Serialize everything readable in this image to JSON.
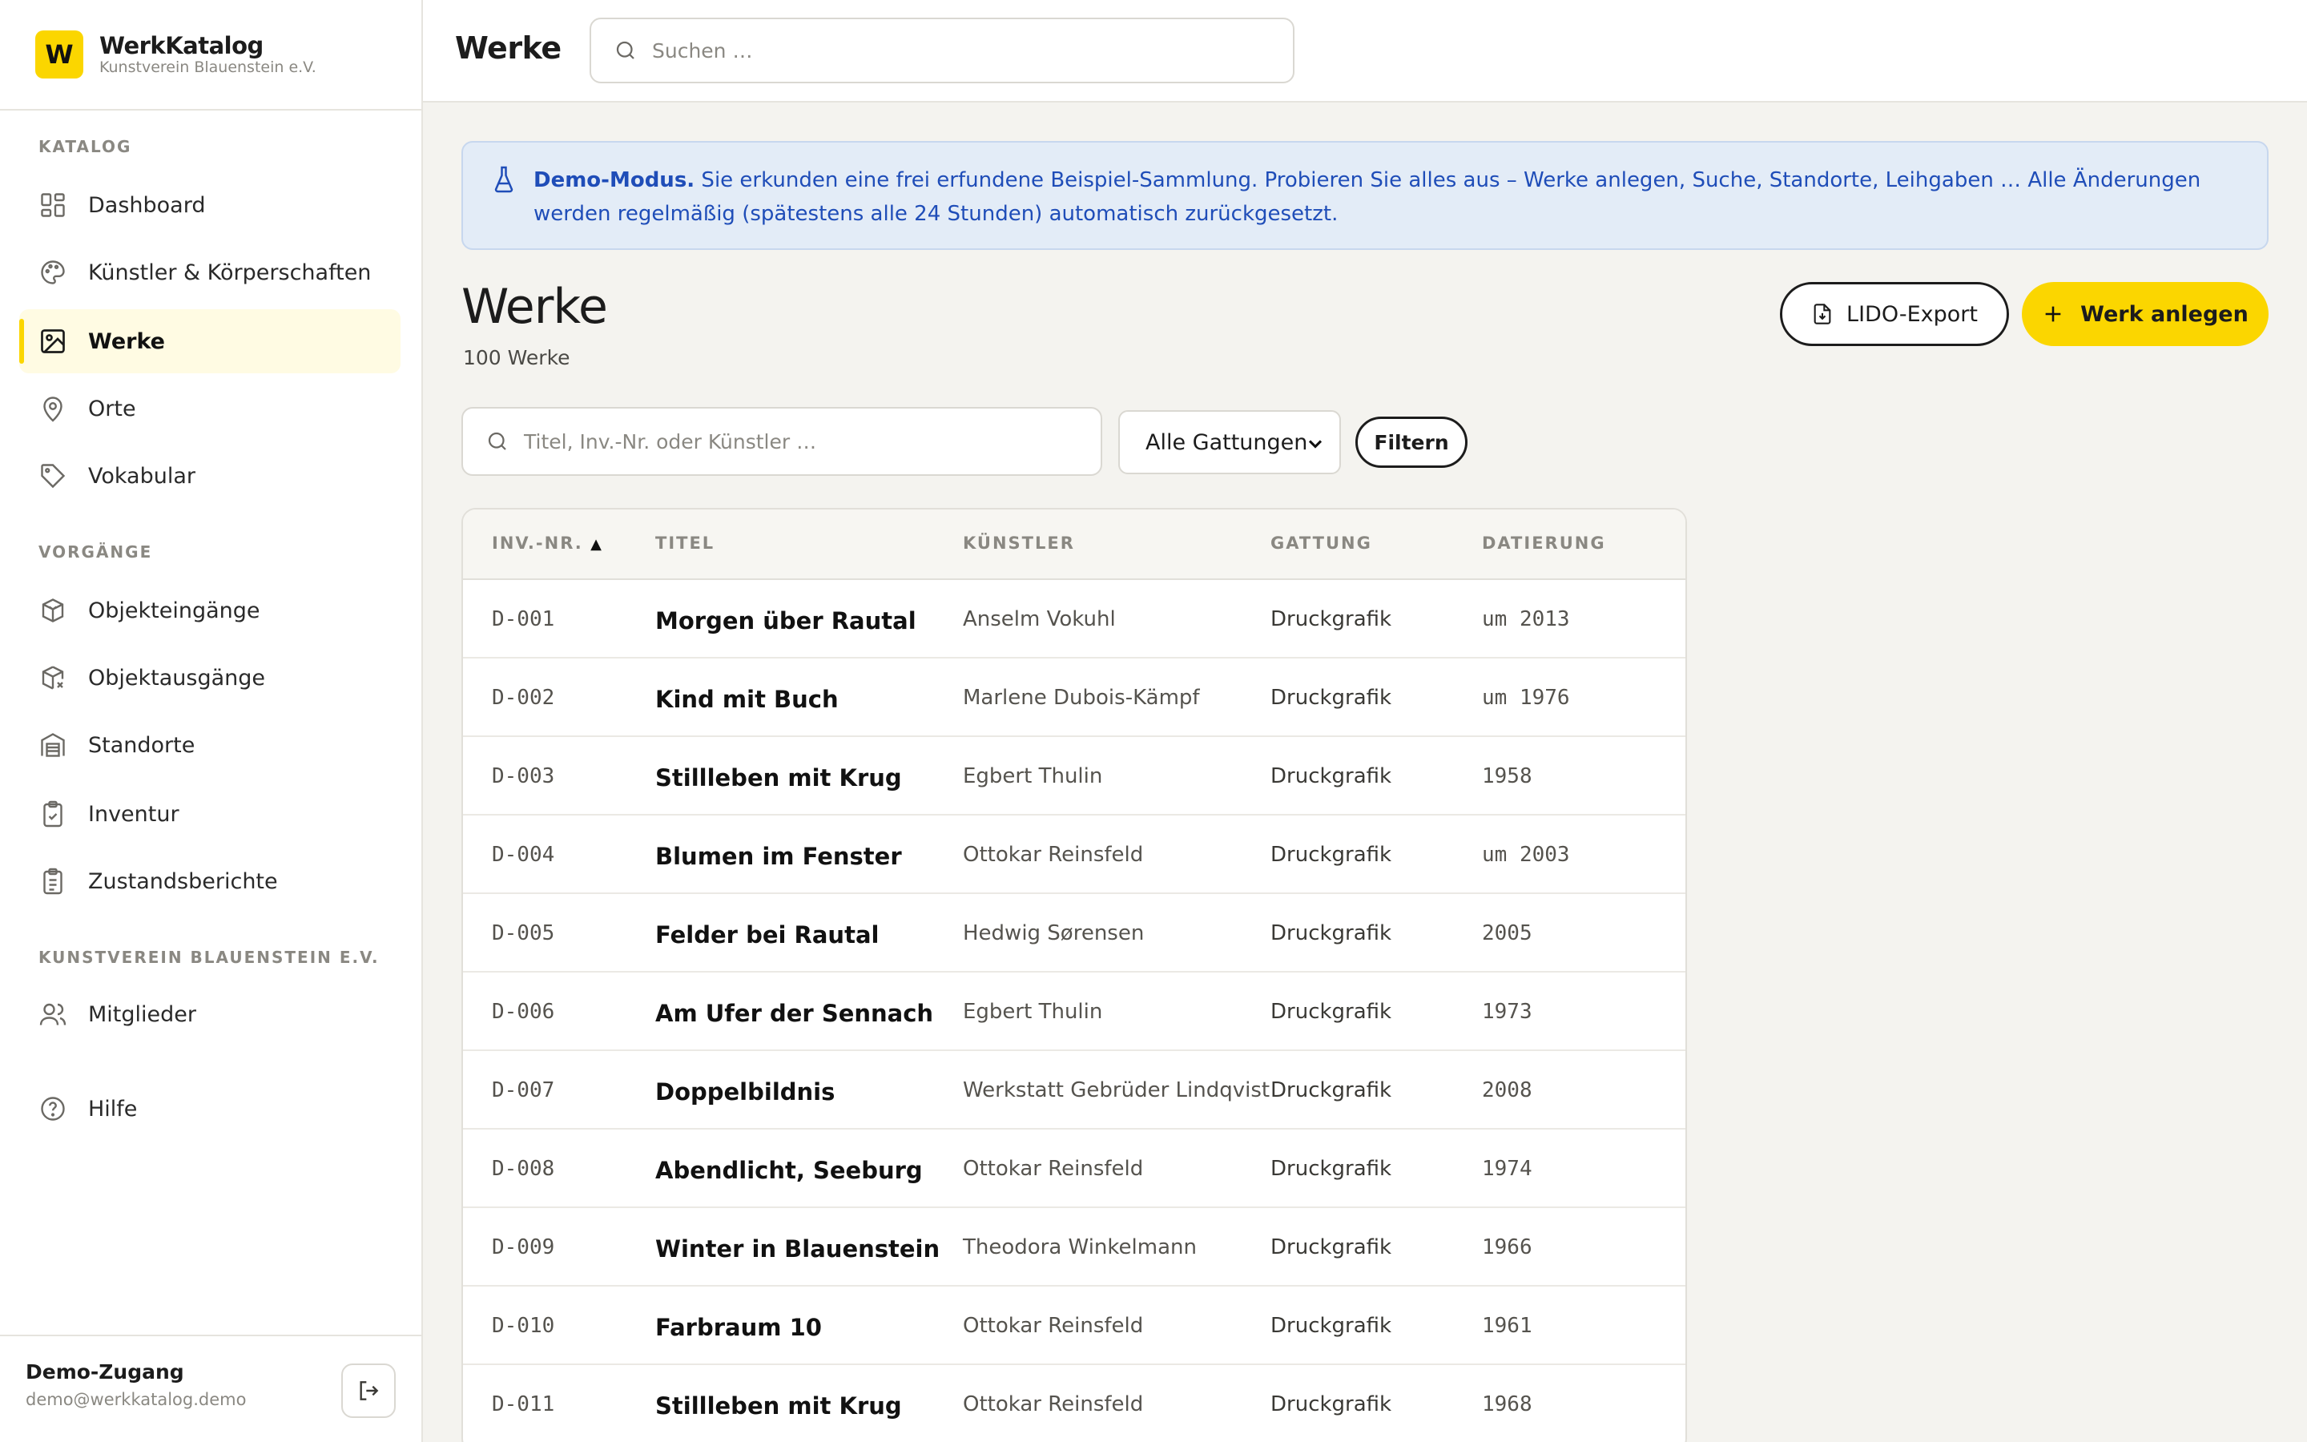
{
  "brand": {
    "logo_letter": "W",
    "name": "WerkKatalog",
    "subtitle": "Kunstverein Blauenstein e.V."
  },
  "sidebar": {
    "sections": {
      "katalog": "KATALOG",
      "vorgaenge": "VORGÄNGE",
      "verein": "KUNSTVEREIN BLAUENSTEIN E.V."
    },
    "items": [
      {
        "label": "Dashboard",
        "icon": "dashboard-icon"
      },
      {
        "label": "Künstler & Körperschaften",
        "icon": "palette-icon"
      },
      {
        "label": "Werke",
        "icon": "image-icon",
        "active": true
      },
      {
        "label": "Orte",
        "icon": "map-pin-icon"
      },
      {
        "label": "Vokabular",
        "icon": "tag-icon"
      },
      {
        "label": "Objekteingänge",
        "icon": "box-in-icon"
      },
      {
        "label": "Objektausgänge",
        "icon": "box-out-icon"
      },
      {
        "label": "Standorte",
        "icon": "warehouse-icon"
      },
      {
        "label": "Inventur",
        "icon": "clipboard-check-icon"
      },
      {
        "label": "Zustandsberichte",
        "icon": "clipboard-list-icon"
      },
      {
        "label": "Mitglieder",
        "icon": "users-icon"
      },
      {
        "label": "Hilfe",
        "icon": "help-icon"
      }
    ],
    "footer": {
      "user_name": "Demo-Zugang",
      "user_email": "demo@werkkatalog.demo"
    }
  },
  "topbar": {
    "title": "Werke",
    "search_placeholder": "Suchen …"
  },
  "banner": {
    "strong": "Demo-Modus.",
    "text": " Sie erkunden eine frei erfundene Beispiel-Sammlung. Probieren Sie alles aus – Werke anlegen, Suche, Standorte, Leihgaben … Alle Änderungen werden regelmäßig (spätestens alle 24 Stunden) automatisch zurückgesetzt."
  },
  "page": {
    "title": "Werke",
    "count": "100 Werke",
    "lido_button": "LIDO-Export",
    "new_button": "Werk anlegen"
  },
  "filters": {
    "search_placeholder": "Titel, Inv.-Nr. oder Künstler …",
    "genre_selected": "Alle Gattungen",
    "filter_button": "Filtern"
  },
  "table": {
    "columns": {
      "inv": "INV.-NR.",
      "sort_indicator": "▲",
      "title": "TITEL",
      "artist": "KÜNSTLER",
      "genre": "GATTUNG",
      "date": "DATIERUNG"
    },
    "rows": [
      {
        "inv": "D-001",
        "title": "Morgen über Rautal",
        "artist": "Anselm Vokuhl",
        "genre": "Druckgrafik",
        "date": "um 2013"
      },
      {
        "inv": "D-002",
        "title": "Kind mit Buch",
        "artist": "Marlene Dubois-Kämpf",
        "genre": "Druckgrafik",
        "date": "um 1976"
      },
      {
        "inv": "D-003",
        "title": "Stillleben mit Krug",
        "artist": "Egbert Thulin",
        "genre": "Druckgrafik",
        "date": "1958"
      },
      {
        "inv": "D-004",
        "title": "Blumen im Fenster",
        "artist": "Ottokar Reinsfeld",
        "genre": "Druckgrafik",
        "date": "um 2003"
      },
      {
        "inv": "D-005",
        "title": "Felder bei Rautal",
        "artist": "Hedwig Sørensen",
        "genre": "Druckgrafik",
        "date": "2005"
      },
      {
        "inv": "D-006",
        "title": "Am Ufer der Sennach",
        "artist": "Egbert Thulin",
        "genre": "Druckgrafik",
        "date": "1973"
      },
      {
        "inv": "D-007",
        "title": "Doppelbildnis",
        "artist": "Werkstatt Gebrüder Lindqvist",
        "genre": "Druckgrafik",
        "date": "2008"
      },
      {
        "inv": "D-008",
        "title": "Abendlicht, Seeburg",
        "artist": "Ottokar Reinsfeld",
        "genre": "Druckgrafik",
        "date": "1974"
      },
      {
        "inv": "D-009",
        "title": "Winter in Blauenstein",
        "artist": "Theodora Winkelmann",
        "genre": "Druckgrafik",
        "date": "1966"
      },
      {
        "inv": "D-010",
        "title": "Farbraum 10",
        "artist": "Ottokar Reinsfeld",
        "genre": "Druckgrafik",
        "date": "1961"
      },
      {
        "inv": "D-011",
        "title": "Stillleben mit Krug",
        "artist": "Ottokar Reinsfeld",
        "genre": "Druckgrafik",
        "date": "1968"
      }
    ]
  },
  "colors": {
    "accent": "#fbd600",
    "banner_text": "#1f4db8",
    "banner_bg": "#e3ecf7"
  }
}
